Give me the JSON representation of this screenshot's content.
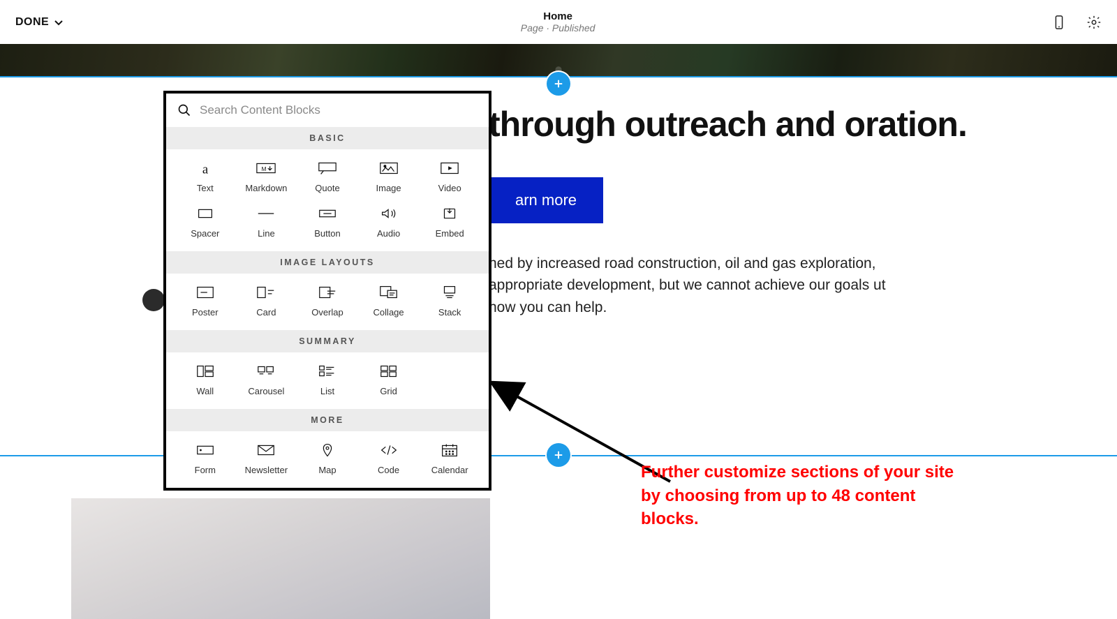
{
  "header": {
    "done_label": "DONE",
    "page_title": "Home",
    "page_subtitle": "Page · Published"
  },
  "search": {
    "placeholder": "Search Content Blocks"
  },
  "categories": [
    {
      "label": "BASIC",
      "items": [
        {
          "name": "text",
          "label": "Text"
        },
        {
          "name": "markdown",
          "label": "Markdown"
        },
        {
          "name": "quote",
          "label": "Quote"
        },
        {
          "name": "image",
          "label": "Image"
        },
        {
          "name": "video",
          "label": "Video"
        },
        {
          "name": "spacer",
          "label": "Spacer"
        },
        {
          "name": "line",
          "label": "Line"
        },
        {
          "name": "button",
          "label": "Button"
        },
        {
          "name": "audio",
          "label": "Audio"
        },
        {
          "name": "embed",
          "label": "Embed"
        }
      ]
    },
    {
      "label": "IMAGE LAYOUTS",
      "items": [
        {
          "name": "poster",
          "label": "Poster"
        },
        {
          "name": "card",
          "label": "Card"
        },
        {
          "name": "overlap",
          "label": "Overlap"
        },
        {
          "name": "collage",
          "label": "Collage"
        },
        {
          "name": "stack",
          "label": "Stack"
        }
      ]
    },
    {
      "label": "SUMMARY",
      "items": [
        {
          "name": "wall",
          "label": "Wall"
        },
        {
          "name": "carousel",
          "label": "Carousel"
        },
        {
          "name": "list",
          "label": "List"
        },
        {
          "name": "grid",
          "label": "Grid"
        }
      ]
    },
    {
      "label": "MORE",
      "items": [
        {
          "name": "form",
          "label": "Form"
        },
        {
          "name": "newsletter",
          "label": "Newsletter"
        },
        {
          "name": "map",
          "label": "Map"
        },
        {
          "name": "code",
          "label": "Code"
        },
        {
          "name": "calendar",
          "label": "Calendar"
        }
      ]
    }
  ],
  "page": {
    "hero_heading": "through outreach and oration.",
    "cta_label": "arn more",
    "body_text": "ned by increased road construction, oil and gas exploration, appropriate development, but we cannot achieve our goals ut how you can help."
  },
  "annotation": {
    "text": "Further customize sections of your site by choosing from up to 48 content blocks."
  },
  "colors": {
    "accent": "#1c9be8",
    "cta": "#0621c4",
    "annotation": "#ff0000"
  }
}
